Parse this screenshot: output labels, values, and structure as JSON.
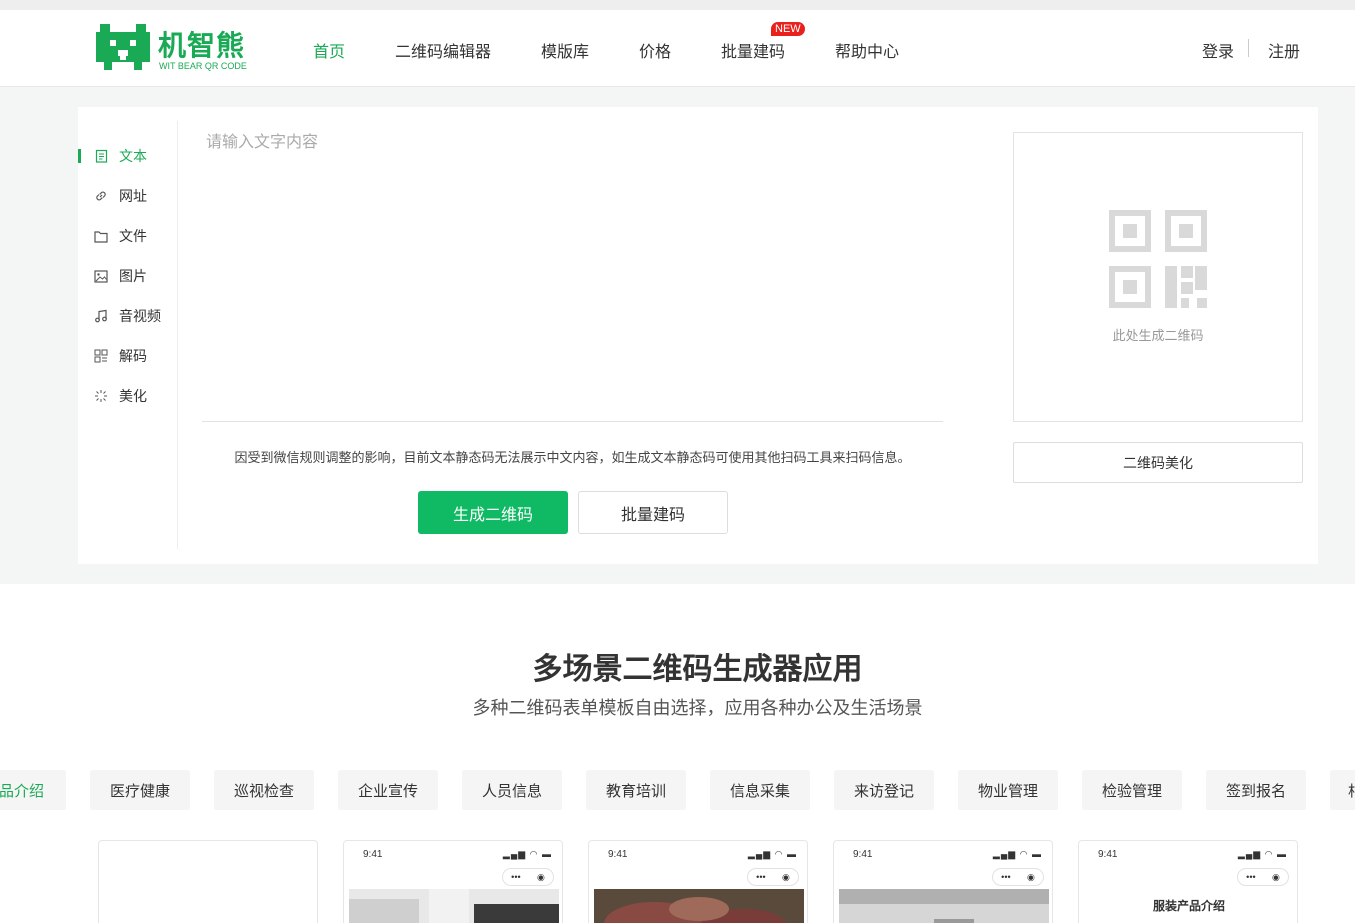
{
  "brand": {
    "name_cn": "机智熊",
    "name_en": "WIT BEAR QR CODE",
    "color": "#1aaa55"
  },
  "nav": {
    "items": [
      {
        "label": "首页",
        "active": true
      },
      {
        "label": "二维码编辑器"
      },
      {
        "label": "模版库"
      },
      {
        "label": "价格"
      },
      {
        "label": "批量建码"
      },
      {
        "label": "帮助中心"
      }
    ],
    "new_badge": "NEW",
    "login": "登录",
    "register": "注册"
  },
  "sidebar": {
    "items": [
      {
        "label": "文本",
        "icon": "document-icon",
        "active": true
      },
      {
        "label": "网址",
        "icon": "link-icon"
      },
      {
        "label": "文件",
        "icon": "folder-icon"
      },
      {
        "label": "图片",
        "icon": "image-icon"
      },
      {
        "label": "音视频",
        "icon": "music-icon"
      },
      {
        "label": "解码",
        "icon": "grid-icon"
      },
      {
        "label": "美化",
        "icon": "sparkle-icon"
      }
    ]
  },
  "editor": {
    "placeholder": "请输入文字内容",
    "notice": "因受到微信规则调整的影响，目前文本静态码无法展示中文内容，如生成文本静态码可使用其他扫码工具来扫码信息。",
    "generate_label": "生成二维码",
    "batch_label": "批量建码"
  },
  "preview": {
    "hint": "此处生成二维码",
    "beautify_label": "二维码美化"
  },
  "scenes": {
    "title": "多场景二维码生成器应用",
    "subtitle": "多种二维码表单模板自由选择，应用各种办公及生活场景",
    "categories": [
      {
        "label": "产品介绍",
        "active": true
      },
      {
        "label": "医疗健康"
      },
      {
        "label": "巡视检查"
      },
      {
        "label": "企业宣传"
      },
      {
        "label": "人员信息"
      },
      {
        "label": "教育培训"
      },
      {
        "label": "信息采集"
      },
      {
        "label": "来访登记"
      },
      {
        "label": "物业管理"
      },
      {
        "label": "检验管理"
      },
      {
        "label": "签到报名"
      },
      {
        "label": "相"
      }
    ],
    "cards": [
      {
        "time": "",
        "title": ""
      },
      {
        "time": "9:41",
        "title": ""
      },
      {
        "time": "9:41",
        "title": ""
      },
      {
        "time": "9:41",
        "title": ""
      },
      {
        "time": "9:41",
        "title": "服装产品介绍"
      }
    ]
  }
}
